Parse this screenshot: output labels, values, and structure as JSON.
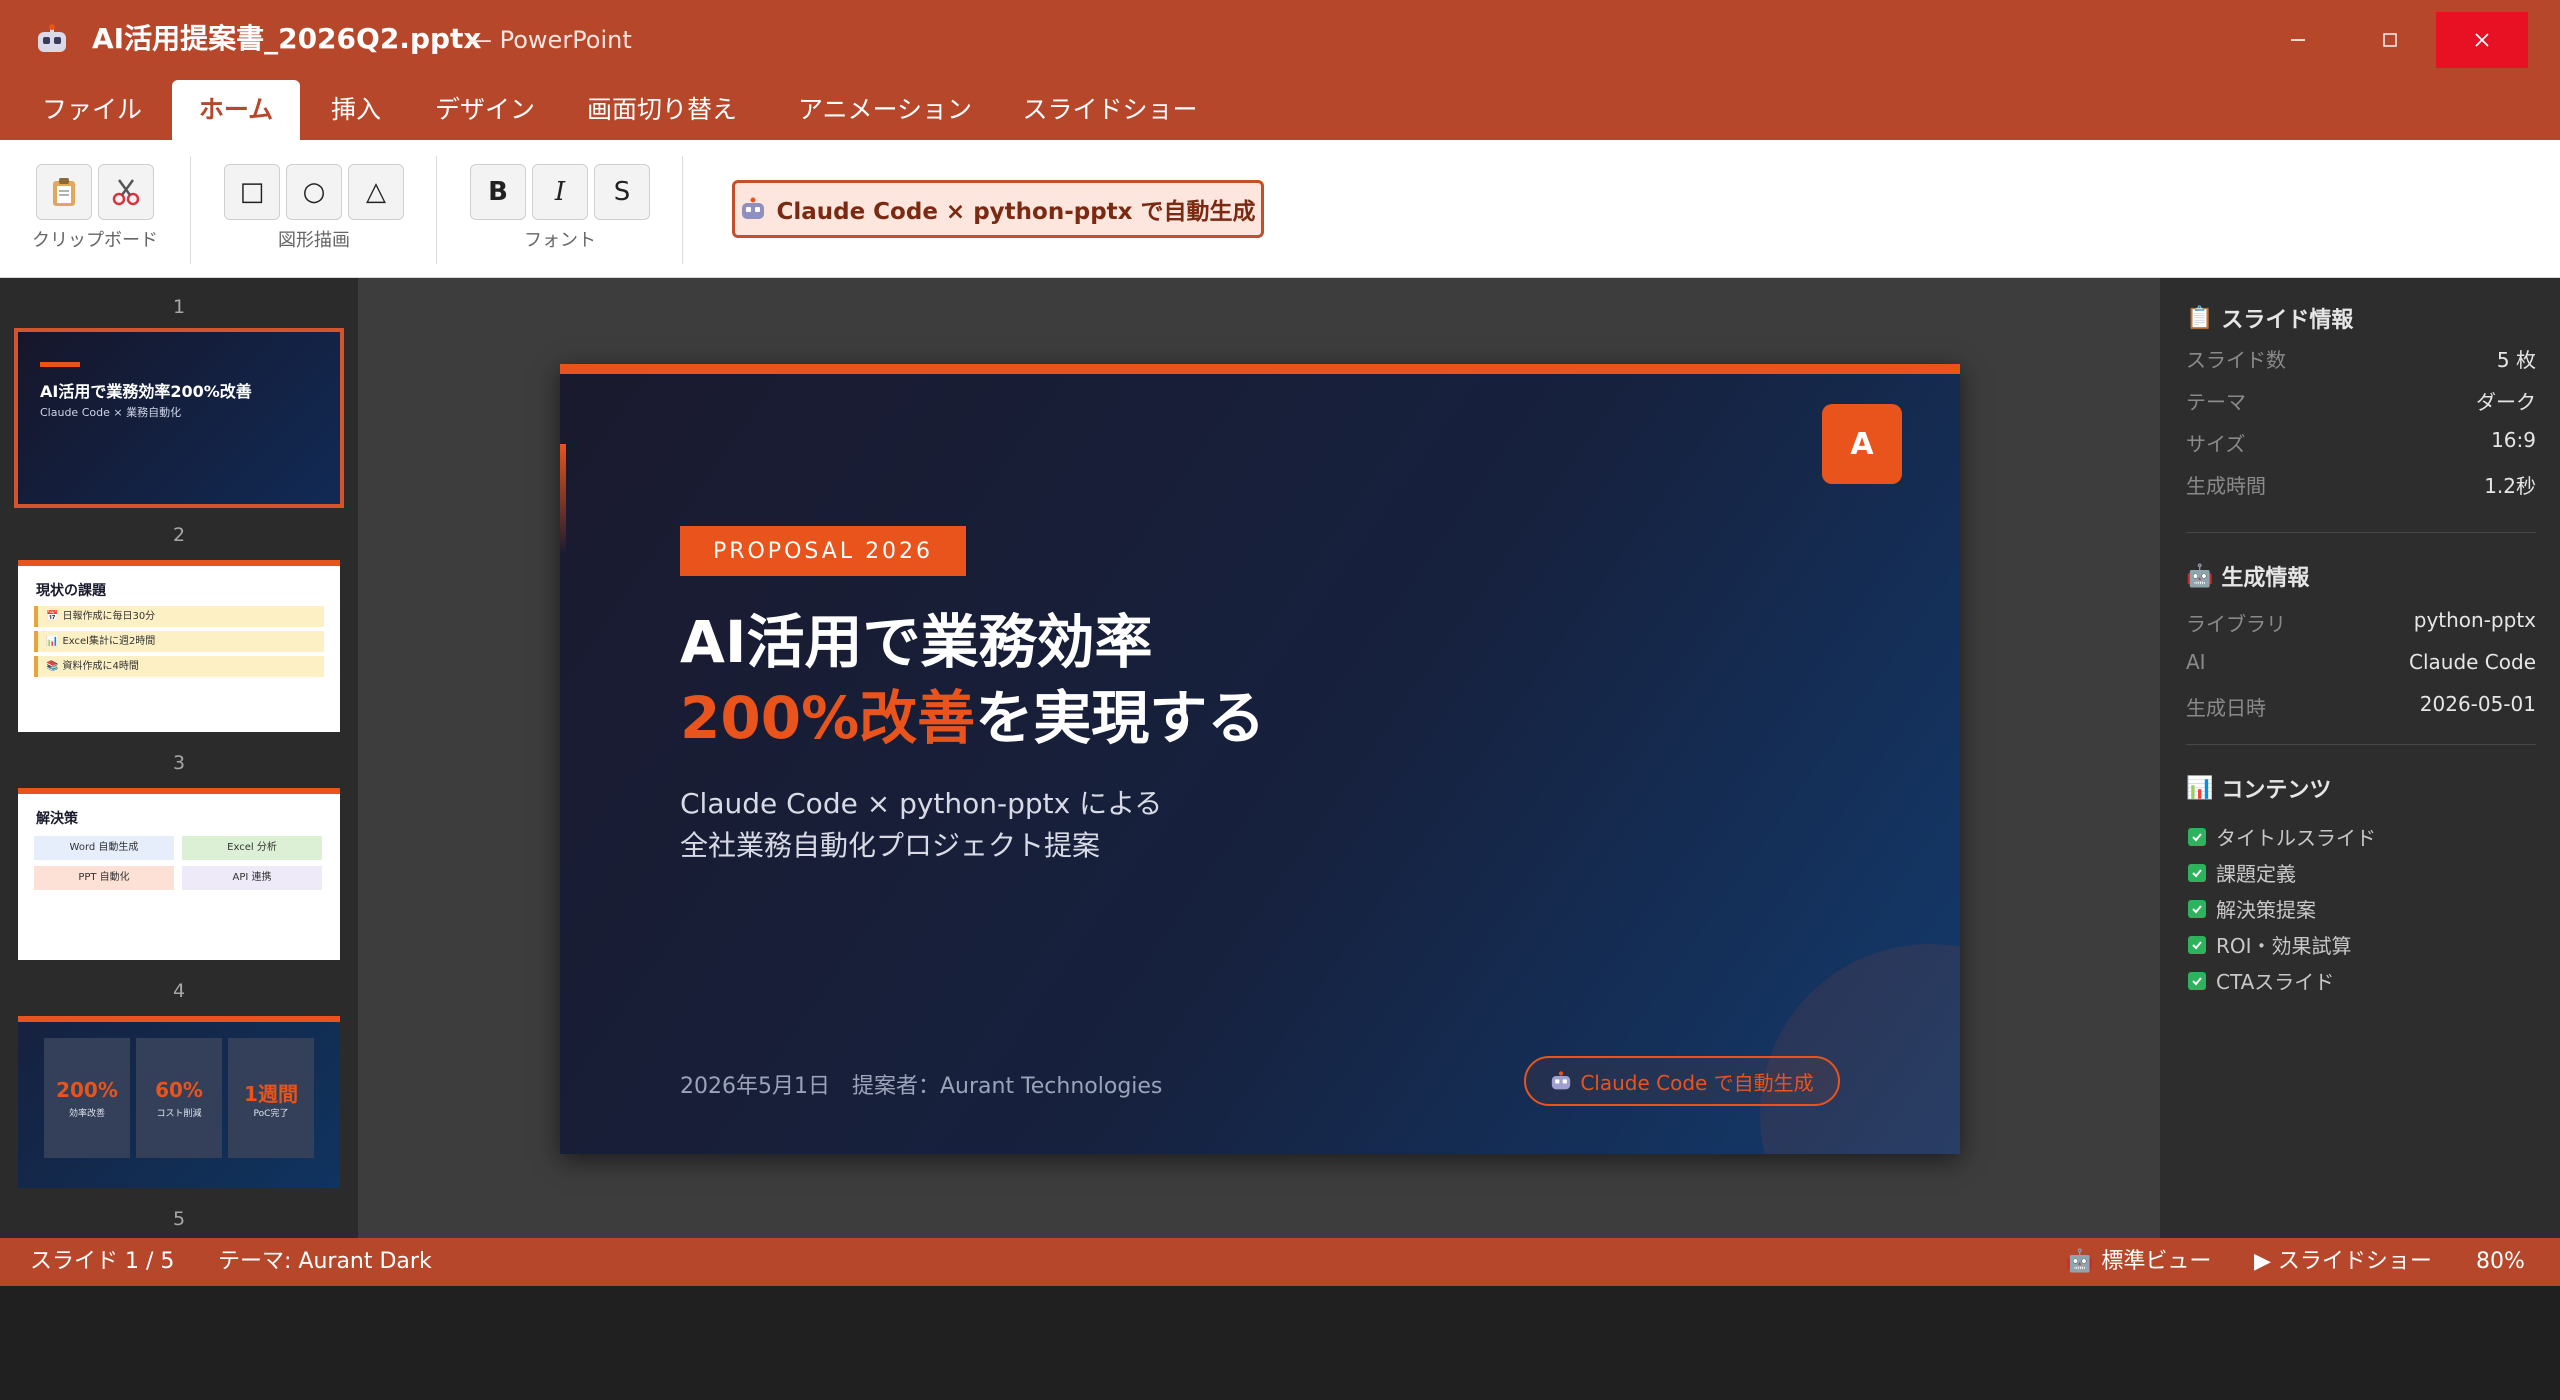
{
  "window": {
    "title": "AI活用提案書_2026Q2.pptx",
    "app_name": "— PowerPoint"
  },
  "tabs": [
    "ファイル",
    "ホーム",
    "挿入",
    "デザイン",
    "画面切り替え",
    "アニメーション",
    "スライドショー"
  ],
  "active_tab": "ホーム",
  "ribbon": {
    "groups": [
      {
        "label": "クリップボード",
        "buttons": [
          "clipboard-icon",
          "scissors-icon"
        ]
      },
      {
        "label": "図形描画",
        "buttons": [
          "□",
          "○",
          "△"
        ]
      },
      {
        "label": "フォント",
        "buttons": [
          "B",
          "I",
          "S"
        ]
      }
    ],
    "badge": "Claude Code × python-pptx で自動生成"
  },
  "thumbnails": {
    "numbers": [
      "1",
      "2",
      "3",
      "4",
      "5"
    ],
    "slide1": {
      "title": "AI活用で業務効率200%改善",
      "subtitle": "Claude Code × 業務自動化"
    },
    "slide2": {
      "title": "現状の課題",
      "items": [
        "日報作成に毎日30分",
        "Excel集計に週2時間",
        "資料作成に4時間"
      ]
    },
    "slide3": {
      "title": "解決策",
      "items": [
        "Word 自動生成",
        "Excel 分析",
        "PPT 自動化",
        "API 連携"
      ]
    },
    "slide4": {
      "stats": [
        {
          "value": "200%",
          "label": "効率改善"
        },
        {
          "value": "60%",
          "label": "コスト削減"
        },
        {
          "value": "1週間",
          "label": "PoC完了"
        }
      ]
    }
  },
  "slide": {
    "logo": "A",
    "badge": "PROPOSAL 2026",
    "title_line1": "AI活用で業務効率",
    "title_accent": "200%改善",
    "title_rest": "を実現する",
    "subtitle_line1": "Claude Code × python-pptx による",
    "subtitle_line2": "全社業務自動化プロジェクト提案",
    "footer": "2026年5月1日　提案者：Aurant Technologies",
    "cc_badge": "Claude Code で自動生成"
  },
  "info_panel": {
    "slide_info": {
      "title": "スライド情報",
      "rows": [
        {
          "key": "スライド数",
          "value": "5 枚"
        },
        {
          "key": "テーマ",
          "value": "ダーク"
        },
        {
          "key": "サイズ",
          "value": "16:9"
        },
        {
          "key": "生成時間",
          "value": "1.2秒"
        }
      ]
    },
    "gen_info": {
      "title": "生成情報",
      "rows": [
        {
          "key": "ライブラリ",
          "value": "python-pptx"
        },
        {
          "key": "AI",
          "value": "Claude Code"
        },
        {
          "key": "生成日時",
          "value": "2026-05-01"
        }
      ]
    },
    "contents": {
      "title": "コンテンツ",
      "items": [
        "タイトルスライド",
        "課題定義",
        "解決策提案",
        "ROI・効果試算",
        "CTAスライド"
      ]
    }
  },
  "status_bar": {
    "slide_pos": "スライド 1 / 5",
    "theme": "テーマ: Aurant Dark",
    "normal_view": "標準ビュー",
    "slideshow": "▶ スライドショー",
    "zoom": "80%"
  },
  "colors": {
    "brand": "#b7472a",
    "accent": "#e8541c",
    "slide_bg": "#16213e",
    "check": "#2db35d"
  }
}
